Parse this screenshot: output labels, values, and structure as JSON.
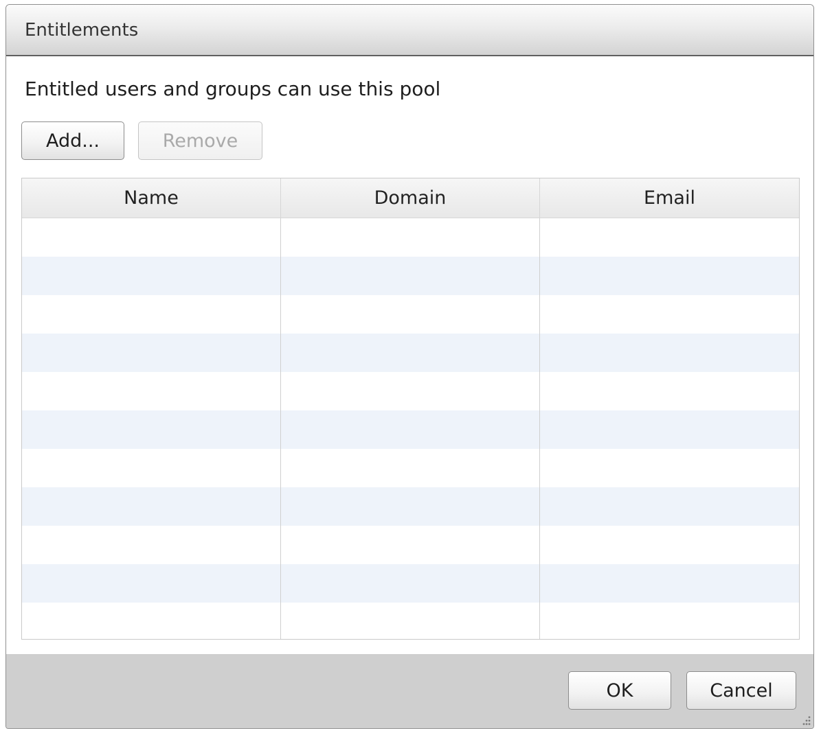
{
  "dialog": {
    "title": "Entitlements",
    "description": "Entitled users and groups can use this pool"
  },
  "toolbar": {
    "add_label": "Add...",
    "remove_label": "Remove",
    "remove_enabled": false
  },
  "table": {
    "columns": [
      "Name",
      "Domain",
      "Email"
    ],
    "rows": []
  },
  "footer": {
    "ok_label": "OK",
    "cancel_label": "Cancel"
  },
  "colors": {
    "row_stripe": "#eef3fa",
    "footer_bg": "#cfcfcf"
  },
  "icons": {
    "resize": "resize-grip-icon"
  }
}
